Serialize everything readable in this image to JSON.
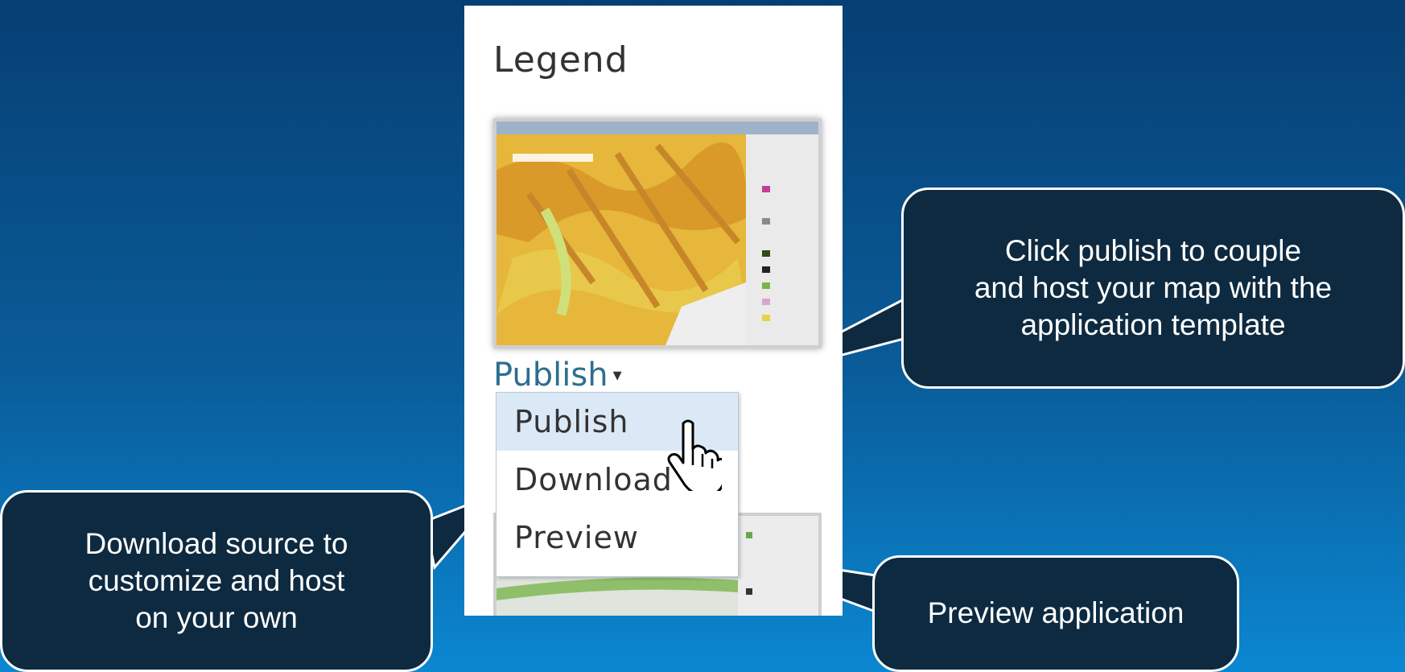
{
  "legend": {
    "title": "Legend"
  },
  "publish_menu": {
    "trigger_label": "Publish",
    "caret": "▾",
    "items": [
      {
        "label": "Publish"
      },
      {
        "label": "Download"
      },
      {
        "label": "Preview"
      }
    ],
    "hovered_index": 0
  },
  "callouts": {
    "publish": {
      "lines": [
        "Click publish to couple",
        "and host your map with the",
        "application template"
      ]
    },
    "download": {
      "lines": [
        "Download source to",
        "customize and host",
        "on your own"
      ]
    },
    "preview": {
      "lines": [
        "Preview application"
      ]
    }
  },
  "colors": {
    "background_top": "#063f73",
    "background_bottom": "#0b87d1",
    "callout_fill": "#0d2a40",
    "link": "#2d6f8e",
    "menu_hover": "#dbe9f7"
  },
  "icons": [
    "dropdown-caret-icon",
    "hand-pointer-cursor-icon"
  ]
}
